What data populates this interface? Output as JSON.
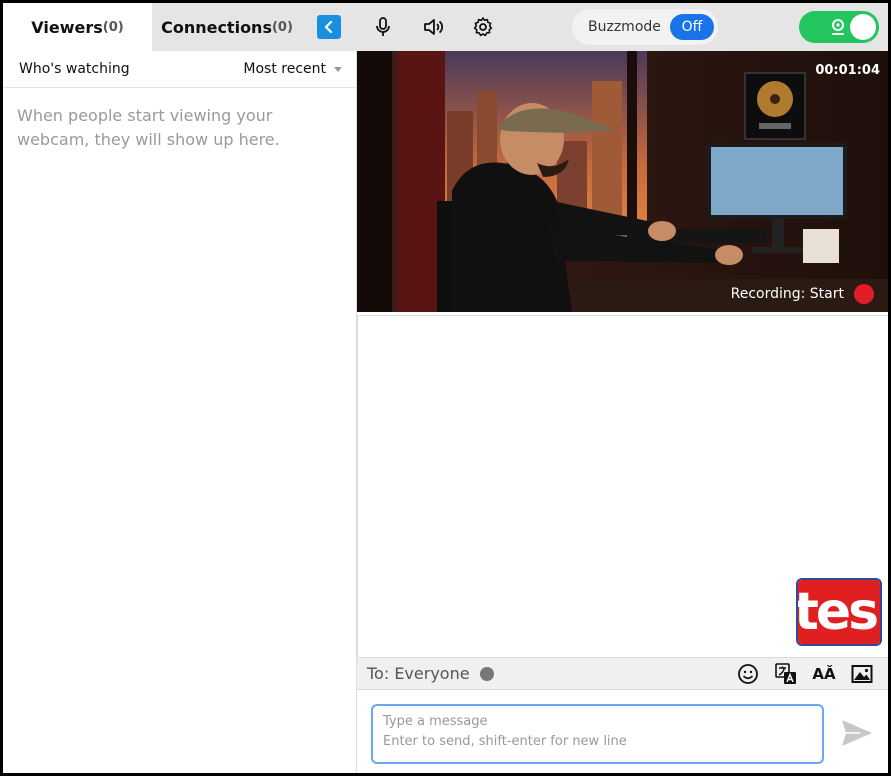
{
  "tabs": {
    "viewers_label": "Viewers",
    "viewers_count": "(0)",
    "connections_label": "Connections",
    "connections_count": "(0)"
  },
  "toolbar": {
    "buzzmode_label": "Buzzmode",
    "buzzmode_state": "Off",
    "icons": [
      "chevron-left-icon",
      "microphone-icon",
      "speaker-icon",
      "gear-icon",
      "webcam-icon"
    ],
    "accent_color": "#1a8fe0",
    "toggle_on_color": "#22c55e"
  },
  "viewers_panel": {
    "filter_label": "Who's watching",
    "sort_label": "Most recent",
    "empty_message": "When people start viewing your webcam, they will show up here."
  },
  "video": {
    "timer": "00:01:04",
    "recording_label": "Recording: Start",
    "recording_color": "#e11d2a"
  },
  "chat": {
    "thumb_text": "tes",
    "to_label": "To: Everyone",
    "tool_icons": [
      "emoji-icon",
      "translate-icon",
      "font-size-icon",
      "image-icon"
    ],
    "font_icon_text": "AǍ",
    "message_placeholder_line1": "Type a message",
    "message_placeholder_line2": "Enter to send, shift-enter for new line"
  }
}
